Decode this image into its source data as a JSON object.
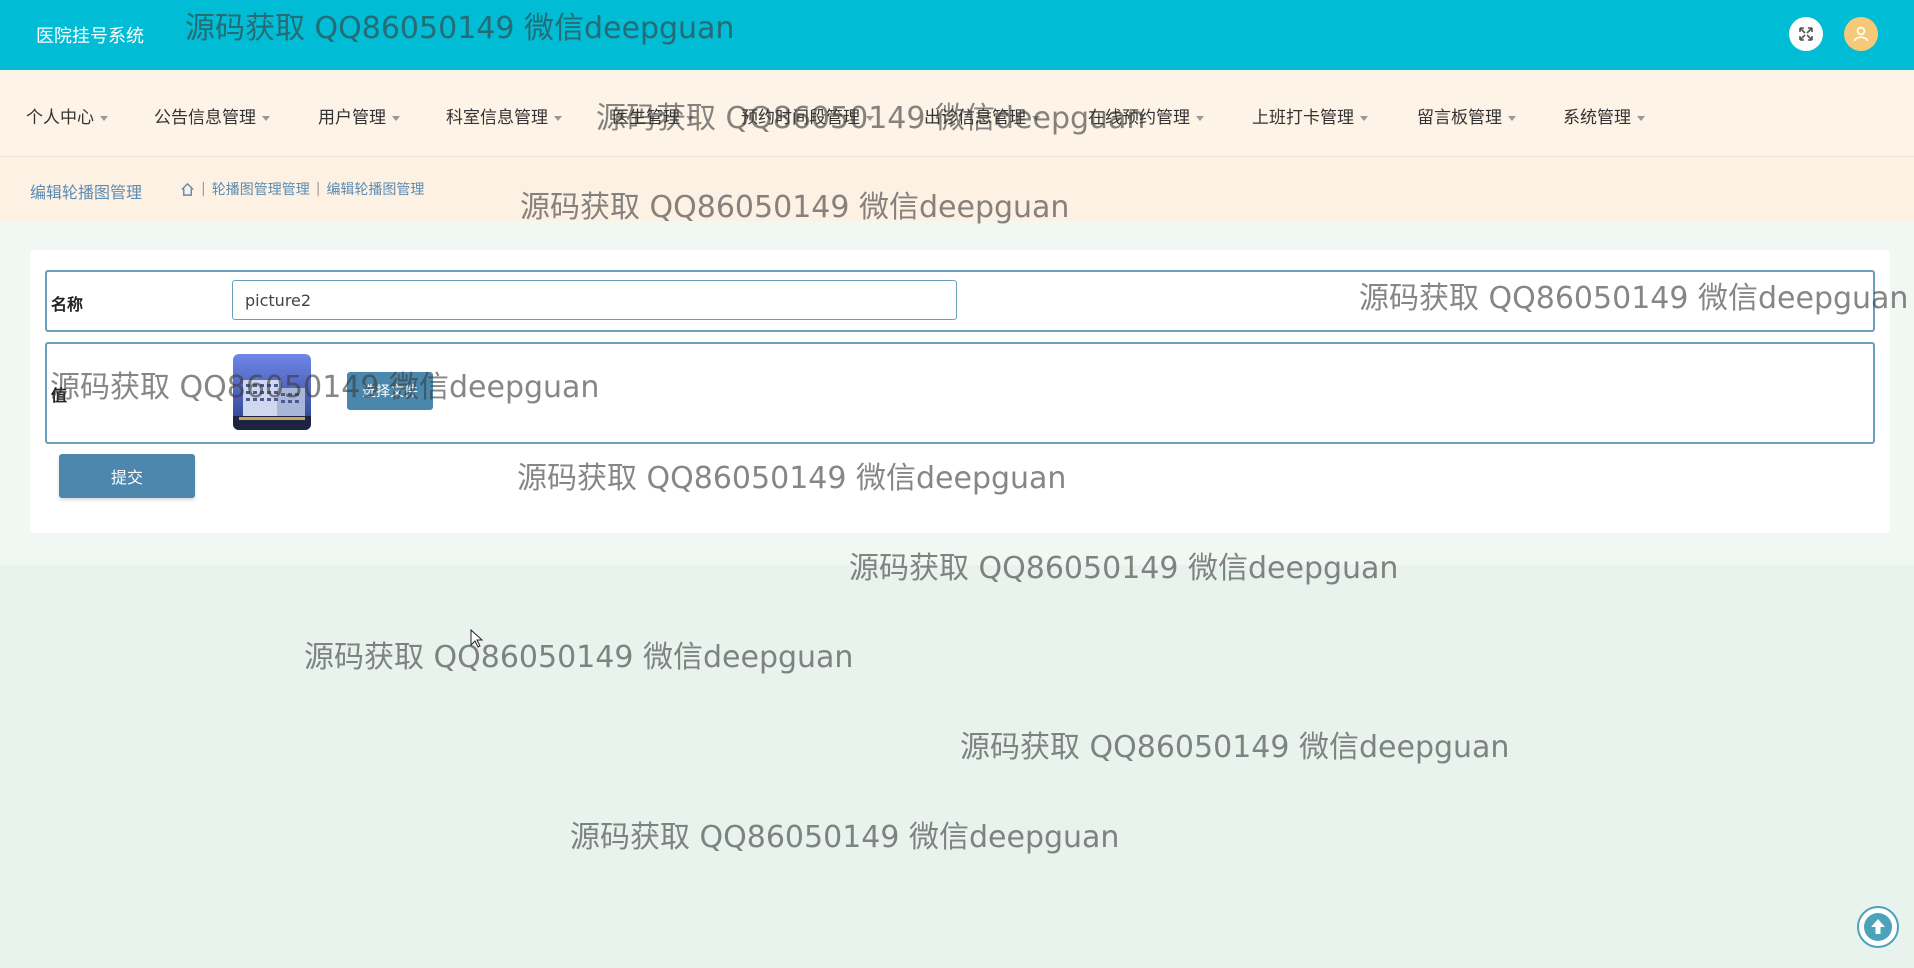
{
  "app": {
    "title": "医院挂号系统"
  },
  "header": {
    "fullscreen_icon": "fullscreen-icon",
    "avatar_icon": "user-avatar-icon",
    "colors": {
      "bar": "#00bcd4",
      "avatar": "#f6c979"
    }
  },
  "nav": {
    "items": [
      {
        "label": "个人中心"
      },
      {
        "label": "公告信息管理"
      },
      {
        "label": "用户管理"
      },
      {
        "label": "科室信息管理"
      },
      {
        "label": "医生管理"
      },
      {
        "label": "预约时间段管理"
      },
      {
        "label": "出诊信息管理"
      },
      {
        "label": "在线预约管理"
      },
      {
        "label": "上班打卡管理"
      },
      {
        "label": "留言板管理"
      },
      {
        "label": "系统管理"
      }
    ]
  },
  "breadcrumb": {
    "title": "编辑轮播图管理",
    "path": [
      "轮播图管理管理",
      "编辑轮播图管理"
    ],
    "home_icon": "home-icon"
  },
  "form": {
    "name_label": "名称",
    "name_value": "picture2",
    "value_label": "值",
    "upload_label": "选择文件",
    "submit_label": "提交"
  },
  "watermark": "源码获取 QQ86050149 微信deepguan",
  "back_to_top_icon": "arrow-up-icon"
}
